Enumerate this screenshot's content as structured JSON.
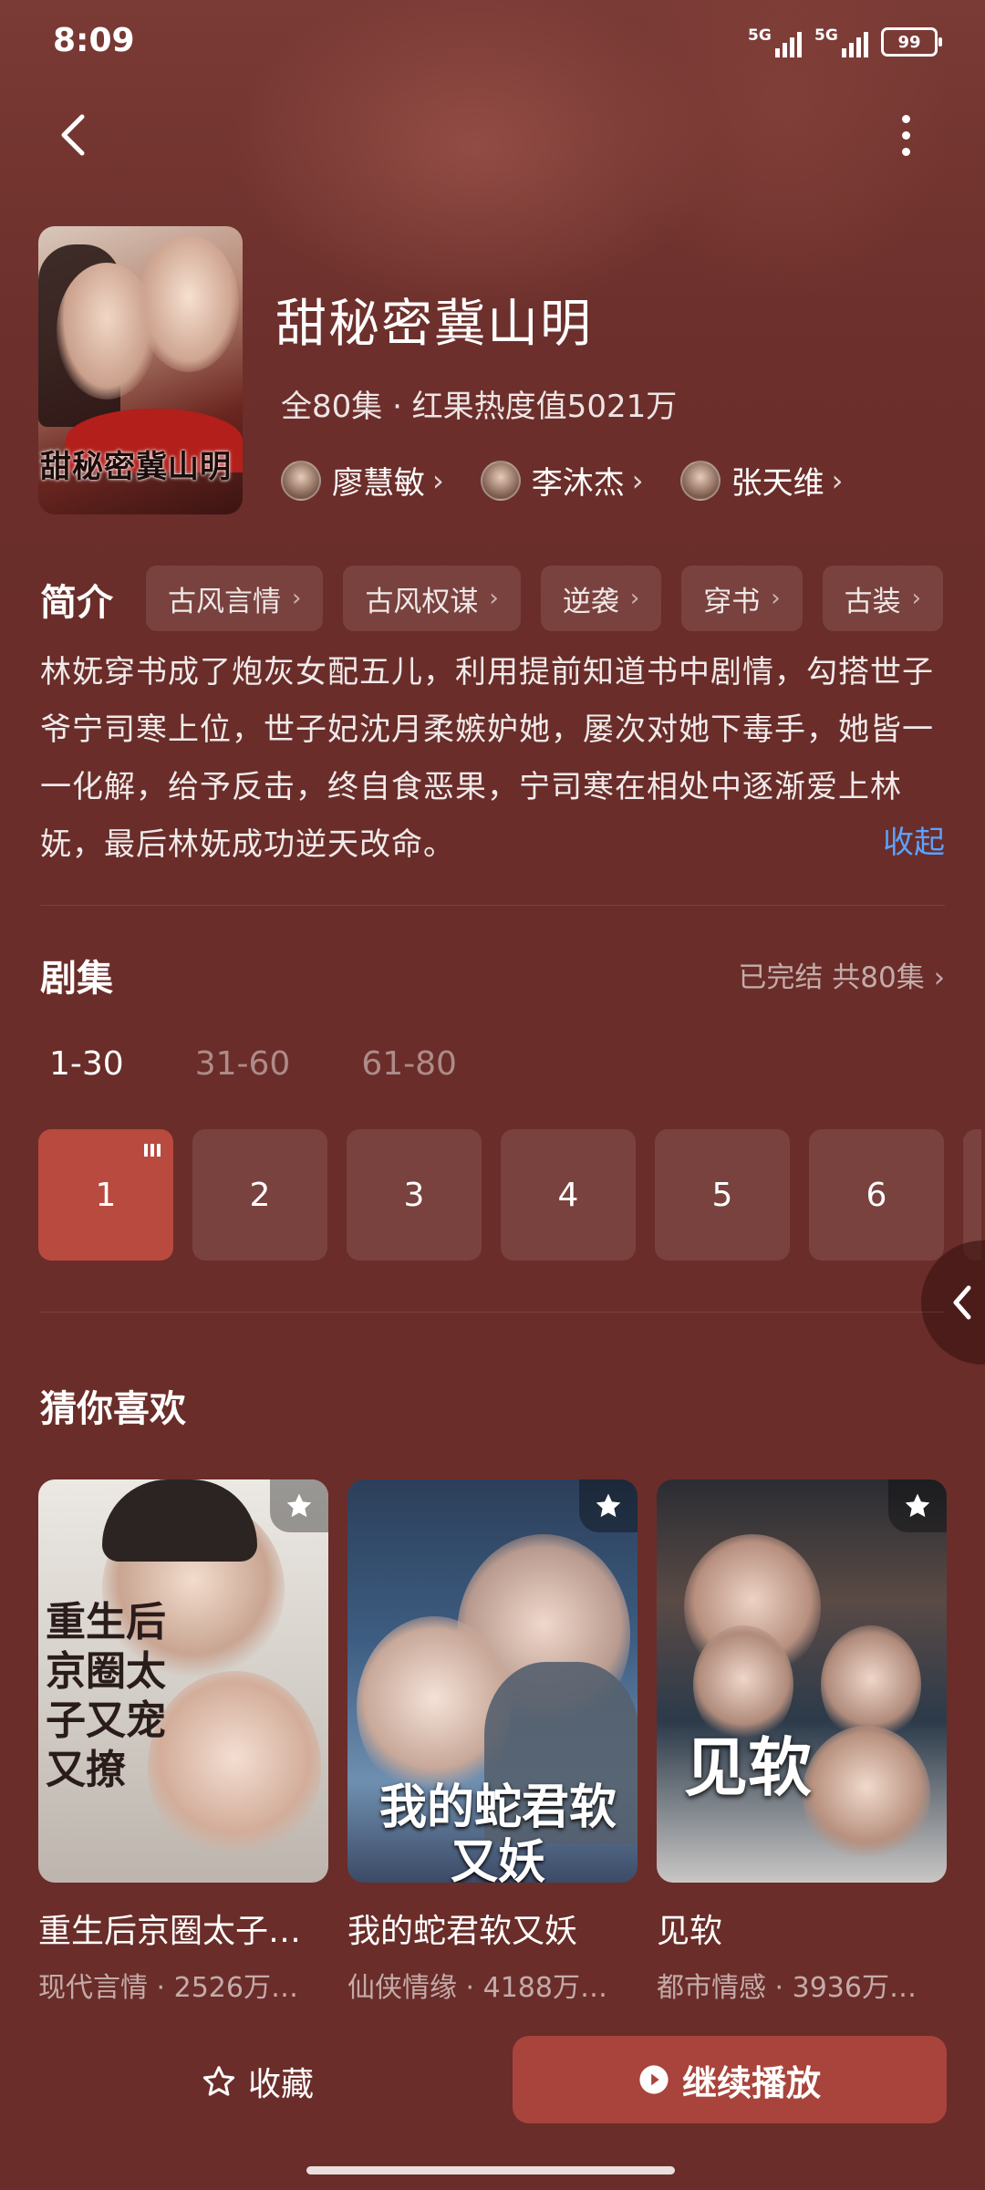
{
  "status_bar": {
    "time": "8:09",
    "signal1": "5G",
    "signal2": "5G",
    "battery": "99"
  },
  "drama": {
    "title": "甜秘密冀山明",
    "poster_text": "甜秘密冀山明",
    "meta": "全80集 · 红果热度值5021万",
    "cast": [
      "廖慧敏",
      "李沐杰",
      "张天维"
    ]
  },
  "intro": {
    "label": "简介",
    "tags": [
      "古风言情",
      "古风权谋",
      "逆袭",
      "穿书",
      "古装"
    ],
    "synopsis": "林妩穿书成了炮灰女配五儿，利用提前知道书中剧情，勾搭世子爷宁司寒上位，世子妃沈月柔嫉妒她，屡次对她下毒手，她皆一一化解，给予反击，终自食恶果，宁司寒在相处中逐渐爱上林妩，最后林妩成功逆天改命。",
    "collapse": "收起"
  },
  "episodes": {
    "label": "剧集",
    "status": "已完结 共80集",
    "ranges": [
      "1-30",
      "31-60",
      "61-80"
    ],
    "items": [
      "1",
      "2",
      "3",
      "4",
      "5",
      "6"
    ]
  },
  "recommend": {
    "label": "猜你喜欢",
    "items": [
      {
        "title": "重生后京圈太子…",
        "meta": "现代言情 · 2526万…",
        "cover_text": "重生后京圈太子又宠又撩"
      },
      {
        "title": "我的蛇君软又妖",
        "meta": "仙侠情缘 · 4188万…",
        "cover_text": "我的蛇君软又妖"
      },
      {
        "title": "见软",
        "meta": "都市情感 · 3936万…",
        "cover_text": "见软"
      }
    ]
  },
  "bottom": {
    "favorite": "收藏",
    "continue": "继续播放"
  },
  "colors": {
    "background": "#6a2d29",
    "accent": "#a8443b",
    "link": "#5aa2ff"
  }
}
